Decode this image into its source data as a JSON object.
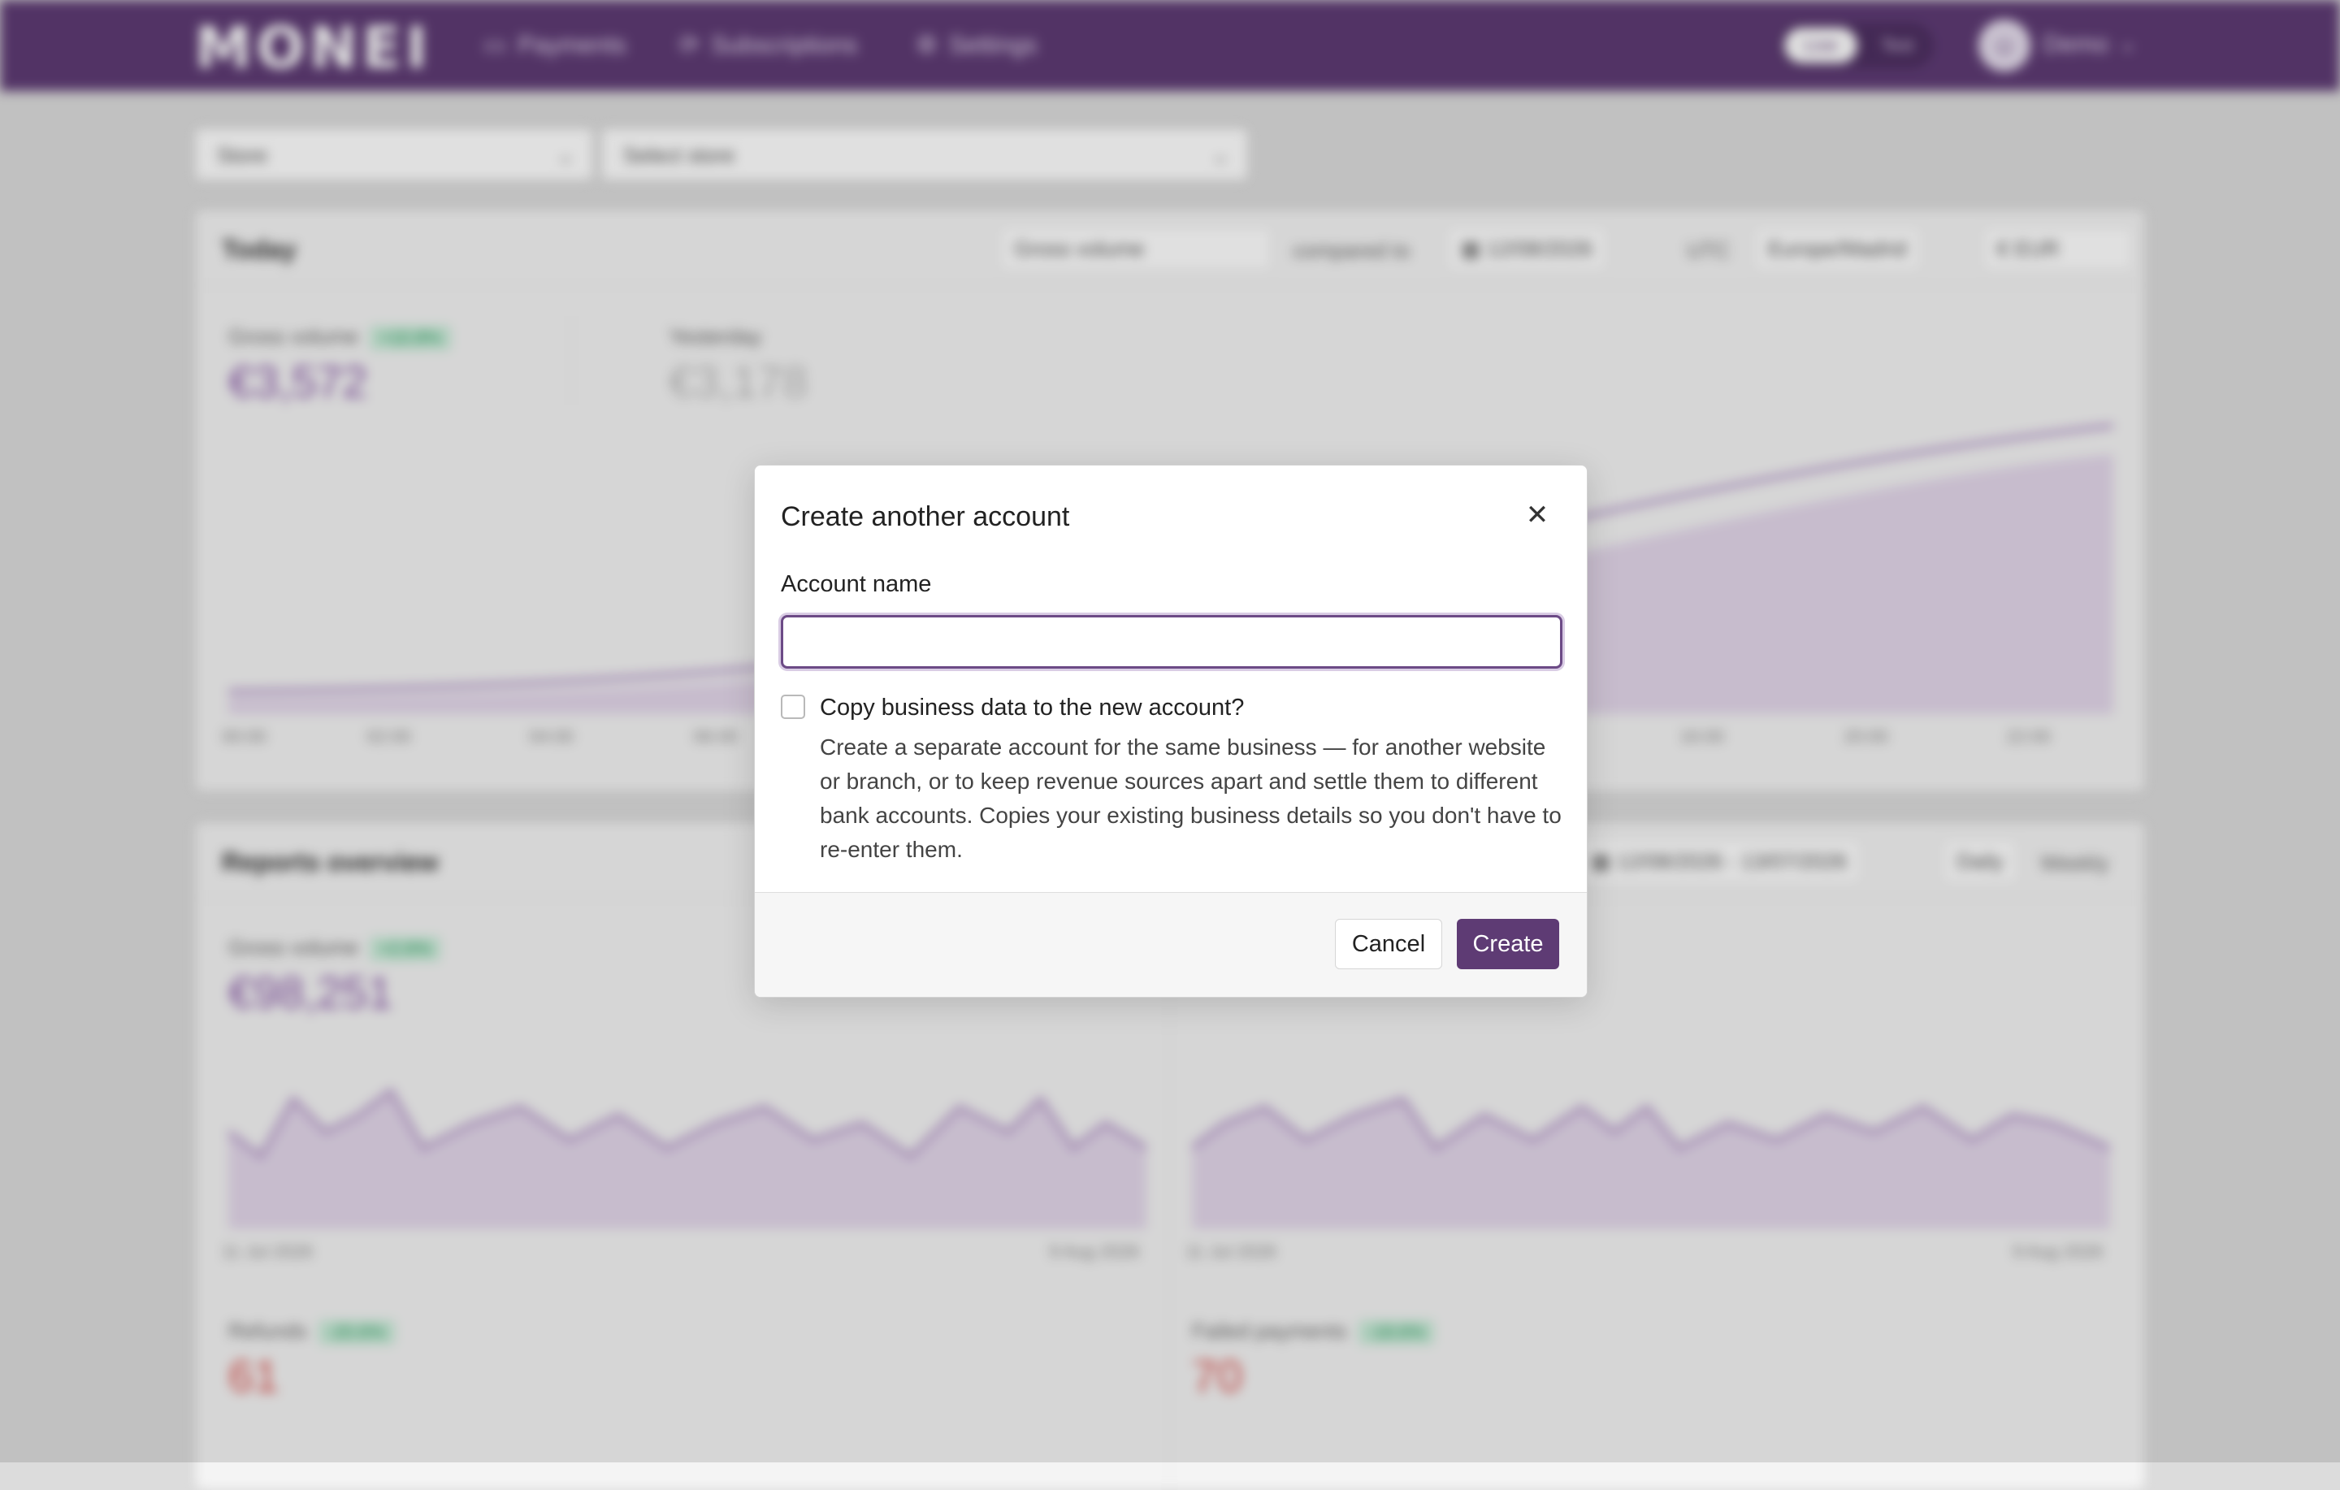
{
  "topbar": {
    "logo": "MONEI",
    "nav": [
      {
        "label": "Payments",
        "icon": "card-icon"
      },
      {
        "label": "Subscriptions",
        "icon": "refresh-icon"
      },
      {
        "label": "Settings",
        "icon": "gear-icon"
      }
    ],
    "env_live": "Live",
    "env_test": "Test",
    "user_name": "Demo"
  },
  "filters": {
    "store": "Store",
    "select_store": "Select store"
  },
  "today_card": {
    "title": "Today",
    "metric_select": "Gross volume",
    "compared_to": "compared to",
    "date": "12/08/2026",
    "utc": "UTC",
    "timezone": "Europe/Madrid",
    "currency": "EUR",
    "gross_label": "Gross volume",
    "gross_badge": "+10.8%",
    "gross_value": "€3,572",
    "yesterday_label": "Yesterday",
    "yesterday_value": "€3,178",
    "ticks": [
      "00:00",
      "02:00",
      "04:00",
      "06:00",
      "16:00",
      "20:00",
      "22:00"
    ]
  },
  "reports_card": {
    "title": "Reports overview",
    "date_range": "12/08/2026 - 13/07/2026",
    "daily": "Daily",
    "weekly": "Weekly",
    "gross_label": "Gross volume",
    "gross_badge": "+2.6%",
    "gross_value": "€98,251",
    "left_start": "11 Jul 2026",
    "left_end": "9 Aug 2026",
    "right_start": "11 Jul 2026",
    "right_end": "9 Aug 2026",
    "refunds_label": "Refunds",
    "refunds_badge": "-20.6%",
    "refunds_value": "61",
    "failed_label": "Failed payments",
    "failed_badge": "-18.6%",
    "failed_value": "70"
  },
  "modal": {
    "title": "Create another account",
    "field_label": "Account name",
    "input_value": "",
    "input_placeholder": "",
    "checkbox_label": "Copy business data to the new account?",
    "checkbox_desc": "Create a separate account for the same business — for another website or branch, or to keep revenue sources apart and settle them to different bank accounts. Copies your existing business details so you don't have to re-enter them.",
    "cancel": "Cancel",
    "create": "Create",
    "close_icon": "close-icon"
  },
  "colors": {
    "brand": "#5e3b74",
    "accent_line": "#8a5aa8"
  }
}
